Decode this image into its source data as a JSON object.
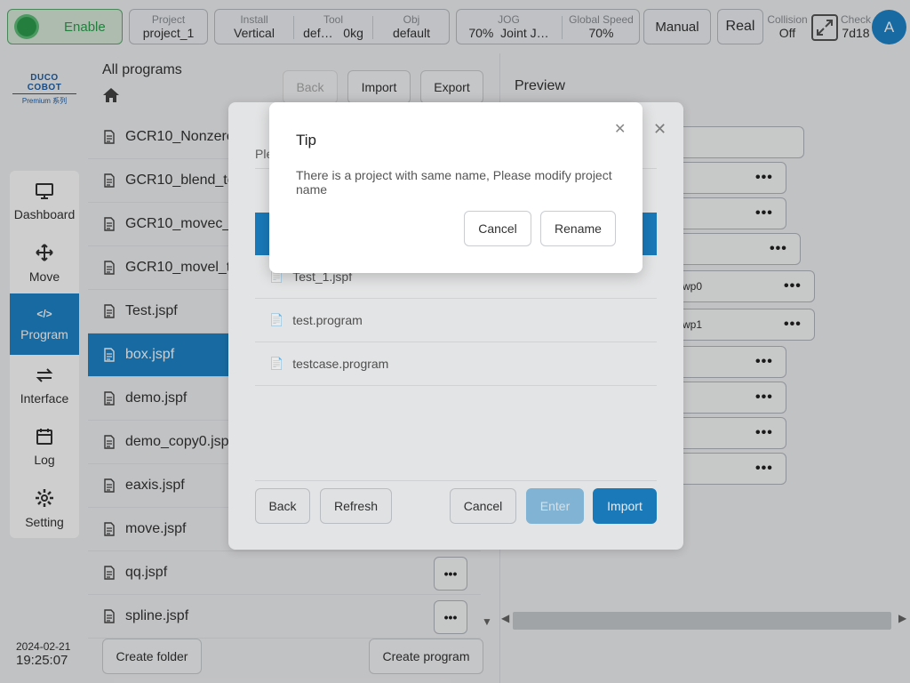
{
  "topbar": {
    "enable_label": "Enable",
    "project": {
      "label": "Project",
      "value": "project_1"
    },
    "install": {
      "label": "Install",
      "value": "Vertical"
    },
    "tool": {
      "label": "Tool",
      "value1": "def…",
      "value2": "0kg"
    },
    "obj": {
      "label": "Obj",
      "value": "default"
    },
    "jog": {
      "label": "JOG",
      "value1": "70%",
      "value2": "Joint J…"
    },
    "speed": {
      "label": "Global Speed",
      "value": "70%"
    },
    "manual_label": "Manual",
    "real_label": "Real",
    "collision": {
      "label": "Collision",
      "value": "Off"
    },
    "check": {
      "label": "Check",
      "value": "7d18"
    },
    "avatar_letter": "A"
  },
  "brand": {
    "name": "DUCO COBOT",
    "sub": "Premium 系列"
  },
  "nav": [
    {
      "label": "Dashboard",
      "icon": "monitor-icon"
    },
    {
      "label": "Move",
      "icon": "move-arrows-icon"
    },
    {
      "label": "Program",
      "icon": "code-icon"
    },
    {
      "label": "Interface",
      "icon": "swap-icon"
    },
    {
      "label": "Log",
      "icon": "calendar-icon"
    },
    {
      "label": "Setting",
      "icon": "gear-icon"
    }
  ],
  "datetime": {
    "date": "2024-02-21",
    "time": "19:25:07"
  },
  "programs": {
    "title": "All programs",
    "back_label": "Back",
    "import_label": "Import",
    "export_label": "Export",
    "items": [
      "GCR10_Nonzero",
      "GCR10_blend_te",
      "GCR10_movec_",
      "GCR10_movel_t",
      "Test.jspf",
      "box.jspf",
      "demo.jspf",
      "demo_copy0.jspf",
      "eaxis.jspf",
      "move.jspf",
      "qq.jspf",
      "spline.jspf"
    ],
    "create_folder_label": "Create folder",
    "create_program_label": "Create program"
  },
  "preview": {
    "title": "Preview",
    "items": [
      "",
      "",
      "",
      "",
      "wp0",
      "wp1",
      "",
      "",
      "",
      ""
    ]
  },
  "import_dialog": {
    "header_partial": "Ple",
    "files": [
      "Test_1.jspf",
      "test.program",
      "testcase.program"
    ],
    "back_label": "Back",
    "refresh_label": "Refresh",
    "cancel_label": "Cancel",
    "enter_label": "Enter",
    "import_label": "Import"
  },
  "tip": {
    "title": "Tip",
    "message": "There is a project with same name, Please modify project name",
    "cancel_label": "Cancel",
    "rename_label": "Rename"
  },
  "colors": {
    "accent": "#1d84c9",
    "enable_green": "#2e9e4f"
  }
}
